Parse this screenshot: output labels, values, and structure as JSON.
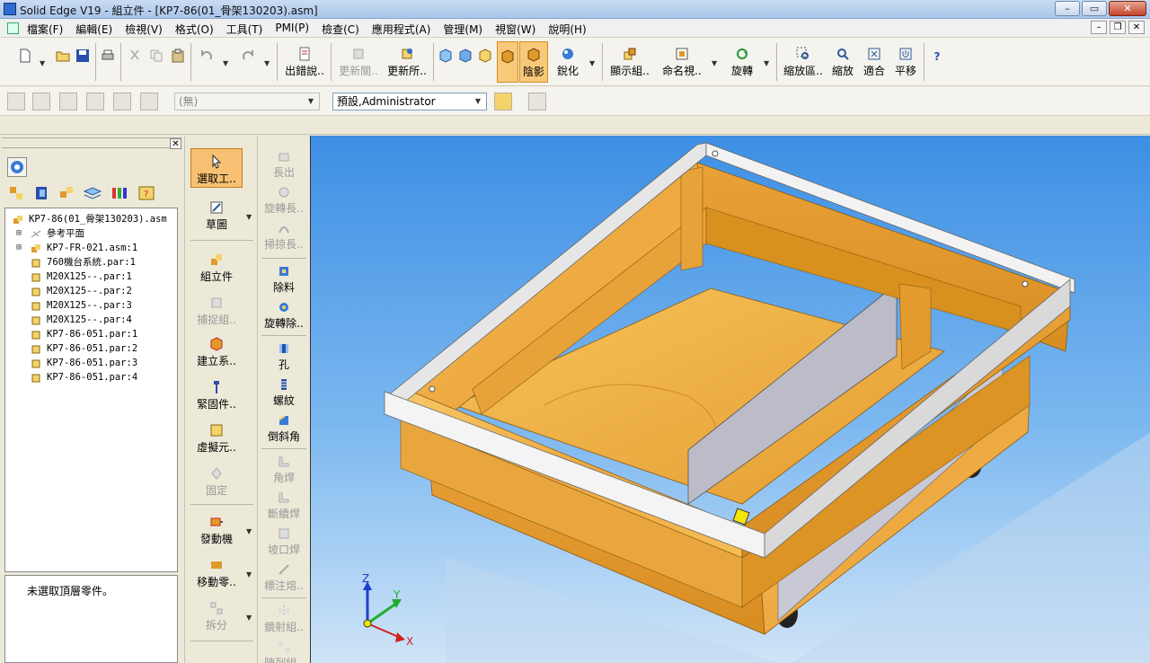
{
  "window": {
    "title": "Solid Edge V19 - 組立件 - [KP7-86(01_骨架130203).asm]"
  },
  "menu": [
    "檔案(F)",
    "編輯(E)",
    "檢視(V)",
    "格式(O)",
    "工具(T)",
    "PMI(P)",
    "檢查(C)",
    "應用程式(A)",
    "管理(M)",
    "視窗(W)",
    "說明(H)"
  ],
  "toolbar": {
    "out_error": "出錯說..",
    "update_link": "更新關..",
    "update_all": "更新所..",
    "shading": "陰影",
    "sharpen": "銳化",
    "show_assembly": "顯示組..",
    "named_view": "命名視..",
    "rotate": "旋轉",
    "zoom_area": "縮放區..",
    "zoom": "縮放",
    "fit": "適合",
    "pan": "平移",
    "help": "?"
  },
  "toolbar2": {
    "combo_none": "(無)",
    "combo_user": "預設,Administrator"
  },
  "tree": {
    "root": "KP7-86(01_骨架130203).asm",
    "items": [
      "參考平面",
      "KP7-FR-021.asm:1",
      "760機台系統.par:1",
      "M20X125--.par:1",
      "M20X125--.par:2",
      "M20X125--.par:3",
      "M20X125--.par:4",
      "KP7-86-051.par:1",
      "KP7-86-051.par:2",
      "KP7-86-051.par:3",
      "KP7-86-051.par:4"
    ],
    "status": "未選取頂層零件。"
  },
  "commands": {
    "select_tool": "選取工..",
    "sketch": "草圖",
    "assembly": "組立件",
    "capture": "捕捉組..",
    "create_system": "建立系..",
    "fastener": "緊固件..",
    "virtual": "虛擬元..",
    "fix": "固定",
    "motor": "發動機",
    "move_part": "移動零..",
    "disperse": "拆分"
  },
  "features": {
    "extrude": "長出",
    "revolve": "旋轉長..",
    "sweep": "掃掠長..",
    "cutout": "除料",
    "revolve_cut": "旋轉除..",
    "hole": "孔",
    "thread": "螺紋",
    "chamfer": "倒斜角",
    "fillet_weld": "角焊",
    "stitch_weld": "斷續焊",
    "groove_weld": "坡口焊",
    "label_weld": "標注熔..",
    "mirror": "鏡射組..",
    "pattern": "陣列組.."
  },
  "axes": {
    "x": "X",
    "y": "Y",
    "z": "Z"
  },
  "colors": {
    "wood": "#f2b54a",
    "sky": "#5ea3ea",
    "active": "#f9c97a"
  }
}
